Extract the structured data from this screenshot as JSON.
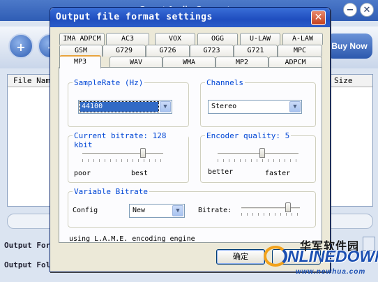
{
  "app": {
    "title": "Smart Audio Converter",
    "add_label": "+",
    "remove_label": "-",
    "buy_label": "Buy Now",
    "minimize_label": "−",
    "close_label": "✕",
    "columns": {
      "file_name": "File Name",
      "size": "Size"
    },
    "output_format_label": "Output Form",
    "output_folder_label": "Output Fold"
  },
  "dialog": {
    "title": "Output file format settings",
    "close_label": "✕",
    "tabs_row1": [
      "IMA ADPCM",
      "AC3",
      "VOX",
      "OGG",
      "U-LAW",
      "A-LAW"
    ],
    "tabs_row2": [
      "GSM",
      "G729",
      "G726",
      "G723",
      "G721",
      "MPC"
    ],
    "tabs_row3": [
      "MP3",
      "WAV",
      "WMA",
      "MP2",
      "ADPCM"
    ],
    "active_tab": "MP3",
    "samplerate": {
      "label": "SampleRate (Hz)",
      "value": "44100"
    },
    "channels": {
      "label": "Channels",
      "value": "Stereo"
    },
    "bitrate": {
      "label": "Current bitrate: 128 kbit",
      "min_label": "poor",
      "max_label": "best",
      "level": 0.75
    },
    "quality": {
      "label": "Encoder quality: 5",
      "min_label": "better",
      "max_label": "faster",
      "level": 0.55
    },
    "vbr": {
      "label": "Variable Bitrate",
      "config_label": "Config",
      "config_value": "New",
      "bitrate_label": "Bitrate:",
      "level": 0.8
    },
    "engine_text": "using L.A.M.E. encoding engine",
    "ok_label": "确定",
    "arrow_glyph": "▼"
  },
  "watermark": {
    "cn": "华军软件园",
    "en": "NLINEDOWN",
    "url": "www.newhua.com"
  }
}
